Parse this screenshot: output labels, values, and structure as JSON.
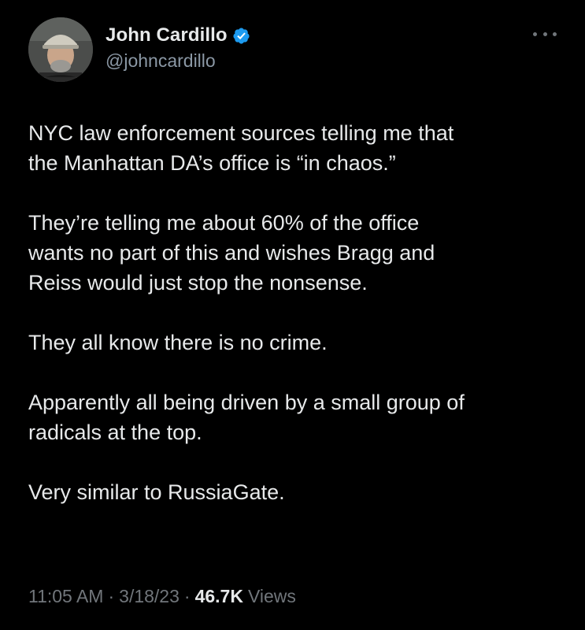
{
  "author": {
    "display_name": "John Cardillo",
    "handle": "@johncardillo",
    "verified": true,
    "avatar_icon": "profile-photo",
    "verified_color": "#1d9bf0"
  },
  "more_icon": "more-horizontal-icon",
  "tweet": {
    "paragraphs": [
      [
        "NYC law enforcement sources telling me that",
        "the Manhattan DA’s office is “in chaos.”"
      ],
      [
        "They’re telling me about 60% of the office",
        "wants no part of this and wishes Bragg and",
        "Reiss would just stop the nonsense."
      ],
      [
        "They all know there is no crime."
      ],
      [
        "Apparently all being driven by a small group of",
        "radicals at the top."
      ],
      [
        "Very similar to RussiaGate."
      ]
    ]
  },
  "meta": {
    "time": "11:05 AM",
    "separator": "·",
    "date": "3/18/23",
    "views_count": "46.7K",
    "views_label": "Views"
  },
  "colors": {
    "background": "#000000",
    "text": "#e7e9ea",
    "secondary": "#71767b"
  }
}
